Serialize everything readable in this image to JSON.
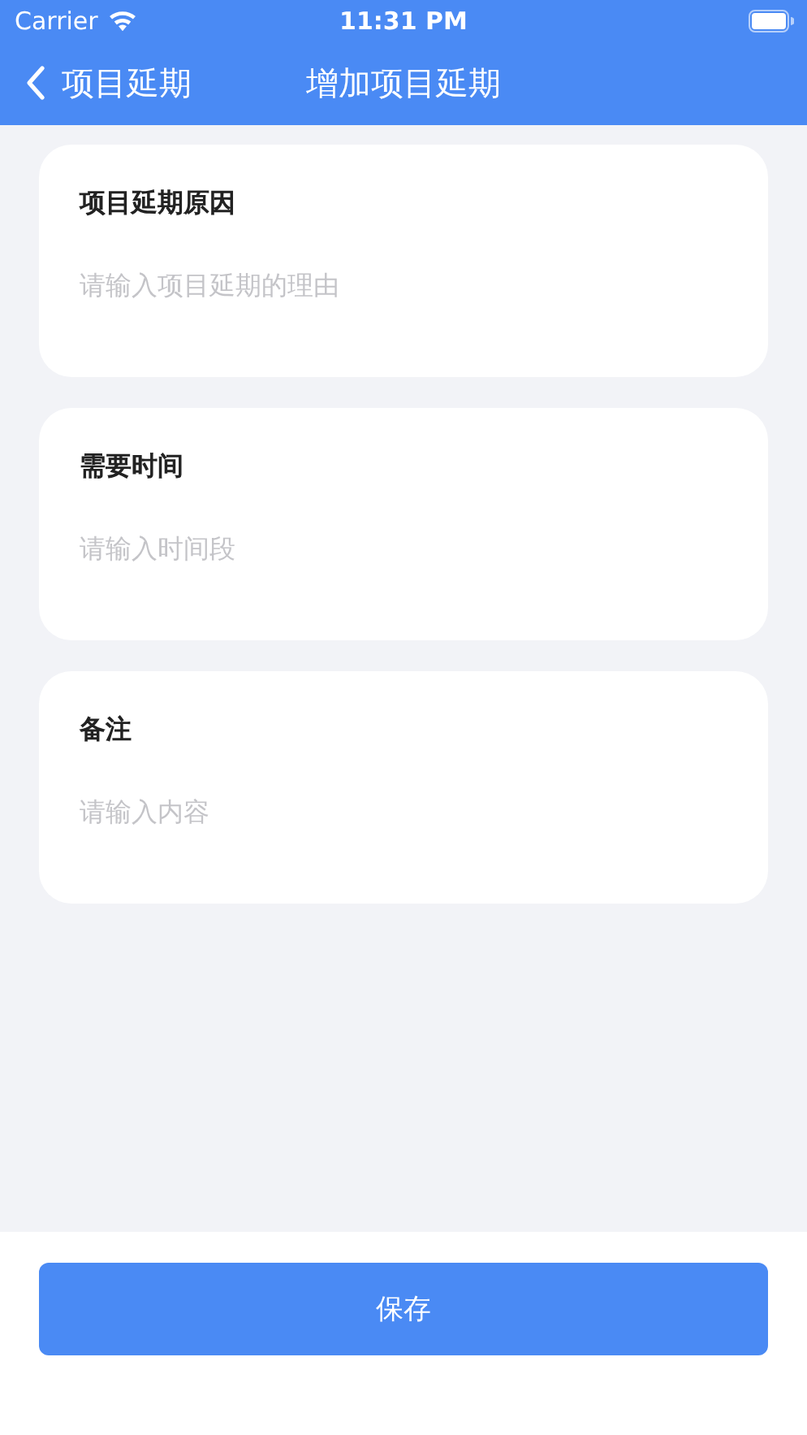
{
  "status_bar": {
    "carrier": "Carrier",
    "time": "11:31 PM"
  },
  "nav": {
    "back_label": "项目延期",
    "title": "增加项目延期"
  },
  "fields": [
    {
      "label": "项目延期原因",
      "placeholder": "请输入项目延期的理由"
    },
    {
      "label": "需要时间",
      "placeholder": "请输入时间段"
    },
    {
      "label": "备注",
      "placeholder": "请输入内容"
    }
  ],
  "save_button": {
    "label": "保存"
  }
}
